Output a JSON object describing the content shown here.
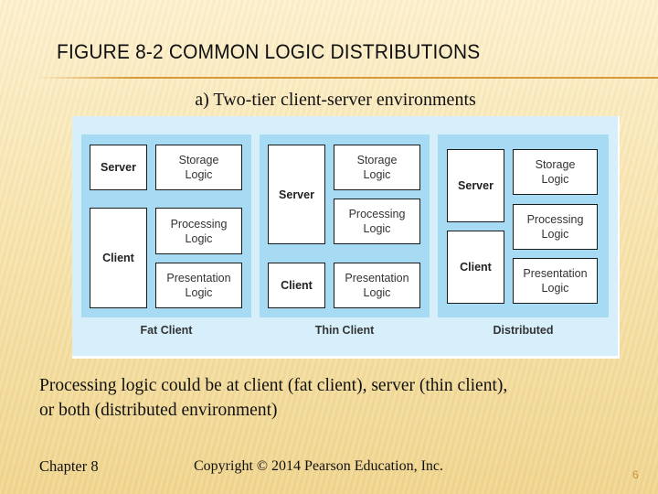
{
  "slide": {
    "title": "FIGURE 8-2 COMMON LOGIC DISTRIBUTIONS",
    "subtitle": "a) Two-tier client-server environments",
    "body_line1": "Processing logic could be at client (fat client), server (thin client),",
    "body_line2": "or both (distributed environment)",
    "footer_chapter": "Chapter 8",
    "footer_copyright": "Copyright © 2014 Pearson Education, Inc.",
    "page_number": "6"
  },
  "figure": {
    "panels": [
      {
        "caption": "Fat Client",
        "boxes": {
          "server": "Server",
          "client": "Client",
          "storage": "Storage\nLogic",
          "processing": "Processing\nLogic",
          "presentation": "Presentation\nLogic"
        }
      },
      {
        "caption": "Thin Client",
        "boxes": {
          "server": "Server",
          "client": "Client",
          "storage": "Storage\nLogic",
          "processing": "Processing\nLogic",
          "presentation": "Presentation\nLogic"
        }
      },
      {
        "caption": "Distributed",
        "boxes": {
          "server": "Server",
          "client": "Client",
          "storage": "Storage\nLogic",
          "processing": "Processing\nLogic",
          "presentation": "Presentation\nLogic"
        }
      }
    ]
  }
}
